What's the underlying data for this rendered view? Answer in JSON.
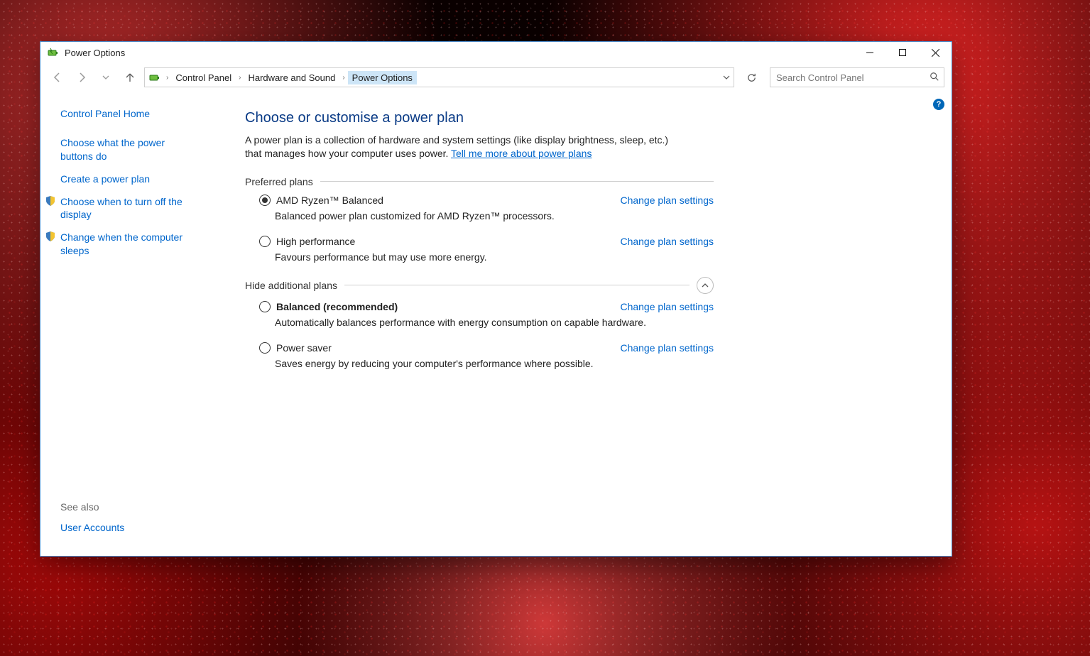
{
  "window": {
    "title": "Power Options"
  },
  "breadcrumb": {
    "items": [
      "Control Panel",
      "Hardware and Sound",
      "Power Options"
    ]
  },
  "search": {
    "placeholder": "Search Control Panel"
  },
  "sidebar": {
    "home": "Control Panel Home",
    "links": [
      "Choose what the power buttons do",
      "Create a power plan",
      "Choose when to turn off the display",
      "Change when the computer sleeps"
    ],
    "see_also_label": "See also",
    "see_also_links": [
      "User Accounts"
    ]
  },
  "main": {
    "heading": "Choose or customise a power plan",
    "description": "A power plan is a collection of hardware and system settings (like display brightness, sleep, etc.) that manages how your computer uses power. ",
    "more_link": "Tell me more about power plans",
    "preferred_label": "Preferred plans",
    "additional_label": "Hide additional plans",
    "change_settings_label": "Change plan settings",
    "plans_preferred": [
      {
        "name": "AMD Ryzen™ Balanced",
        "desc": "Balanced power plan customized for AMD Ryzen™ processors.",
        "selected": true,
        "bold": false
      },
      {
        "name": "High performance",
        "desc": "Favours performance but may use more energy.",
        "selected": false,
        "bold": false
      }
    ],
    "plans_additional": [
      {
        "name": "Balanced (recommended)",
        "desc": "Automatically balances performance with energy consumption on capable hardware.",
        "selected": false,
        "bold": true
      },
      {
        "name": "Power saver",
        "desc": "Saves energy by reducing your computer's performance where possible.",
        "selected": false,
        "bold": false
      }
    ]
  }
}
